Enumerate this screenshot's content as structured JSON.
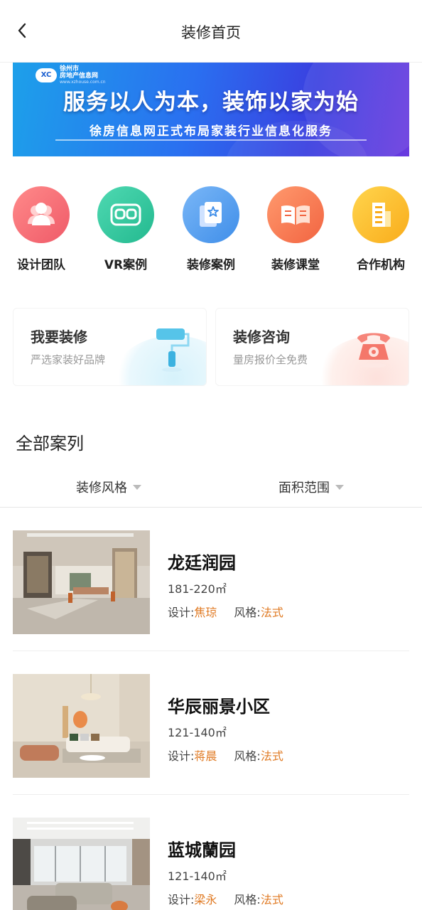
{
  "header": {
    "title": "装修首页"
  },
  "banner": {
    "logo_city": "徐州市",
    "logo_name": "房地产信息网",
    "logo_url": "www.xzhouse.com.cn",
    "slogan": "服务以人为本，装饰以家为始",
    "subtitle": "徐房信息网正式布局家装行业信息化服务"
  },
  "categories": [
    {
      "label": "设计团队",
      "icon": "team-icon",
      "color": "#f2646e"
    },
    {
      "label": "VR案例",
      "icon": "vr-goggles-icon",
      "color": "#2fc8a0"
    },
    {
      "label": "装修案例",
      "icon": "case-cards-icon",
      "color": "#4d9df2"
    },
    {
      "label": "装修课堂",
      "icon": "open-book-icon",
      "color": "#f5774f"
    },
    {
      "label": "合作机构",
      "icon": "building-icon",
      "color": "#fbbe2d"
    }
  ],
  "cards": [
    {
      "title": "我要装修",
      "subtitle": "严选家装好品牌",
      "icon": "paint-roller-icon"
    },
    {
      "title": "装修咨询",
      "subtitle": "量房报价全免费",
      "icon": "telephone-icon"
    }
  ],
  "section": {
    "title": "全部案列"
  },
  "filters": [
    {
      "label": "装修风格"
    },
    {
      "label": "面积范围"
    }
  ],
  "cases": [
    {
      "name": "龙廷润园",
      "area": "181-220㎡",
      "designer_label": "设计:",
      "designer": "焦琼",
      "style_label": "风格:",
      "style": "法式"
    },
    {
      "name": "华辰丽景小区",
      "area": "121-140㎡",
      "designer_label": "设计:",
      "designer": "蒋晨",
      "style_label": "风格:",
      "style": "法式"
    },
    {
      "name": "蓝城蘭园",
      "area": "121-140㎡",
      "designer_label": "设计:",
      "designer": "梁永",
      "style_label": "风格:",
      "style": "法式"
    }
  ],
  "colors": {
    "accent": "#e07a23",
    "banner_start": "#1da0ea",
    "banner_end": "#6a3adf"
  }
}
